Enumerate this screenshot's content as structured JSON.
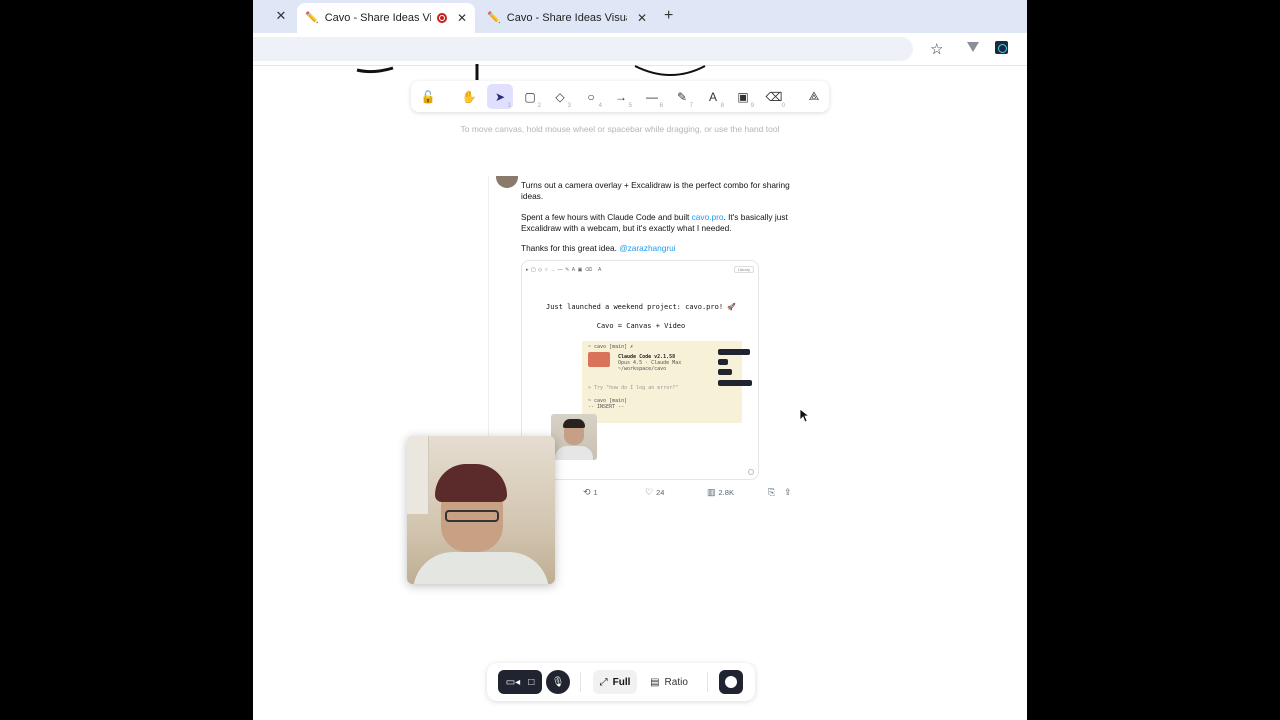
{
  "browser": {
    "tabs": [
      {
        "title": "Cavo - Share Ideas Visually",
        "favicon": "pencil-icon",
        "recording": true,
        "active": true
      },
      {
        "title": "Cavo - Share Ideas Visually |",
        "favicon": "pencil-icon",
        "recording": false,
        "active": false
      }
    ],
    "close_symbol": "✕",
    "new_tab_symbol": "+",
    "bookmark_icon": "☆"
  },
  "toolbar": {
    "tools": [
      {
        "name": "lock-icon",
        "glyph": "🔓",
        "num": ""
      },
      {
        "name": "hand-icon",
        "glyph": "✋",
        "num": ""
      },
      {
        "name": "selection-icon",
        "glyph": "➤",
        "num": "1",
        "selected": true
      },
      {
        "name": "rectangle-icon",
        "glyph": "▢",
        "num": "2"
      },
      {
        "name": "diamond-icon",
        "glyph": "◇",
        "num": "3"
      },
      {
        "name": "ellipse-icon",
        "glyph": "○",
        "num": "4"
      },
      {
        "name": "arrow-icon",
        "glyph": "→",
        "num": "5"
      },
      {
        "name": "line-icon",
        "glyph": "—",
        "num": "6"
      },
      {
        "name": "pencil-icon",
        "glyph": "✎",
        "num": "7"
      },
      {
        "name": "text-icon",
        "glyph": "A",
        "num": "8"
      },
      {
        "name": "image-icon",
        "glyph": "▣",
        "num": "9"
      },
      {
        "name": "eraser-icon",
        "glyph": "⌫",
        "num": "0"
      },
      {
        "name": "shapes-icon",
        "glyph": "⟁",
        "num": ""
      }
    ],
    "hint": "To move canvas, hold mouse wheel or spacebar while dragging, or use the hand tool"
  },
  "tweet": {
    "line1": "Turns out a camera overlay + Excalidraw is the perfect combo for sharing ideas.",
    "p2_before": "Spent a few hours with Claude Code and built ",
    "p2_link": "cavo.pro",
    "p2_after": ". It's basically just Excalidraw with a webcam, but it's exactly what I needed.",
    "p3_before": "Thanks for this great idea. ",
    "p3_link": "@zarazhangrui",
    "media": {
      "library_label": "Library",
      "handwritten_1": "Just launched a weekend project: cavo.pro! 🚀",
      "handwritten_2": "Cavo = Canvas + Video",
      "term_prompt": "~ cavo [main] ✗",
      "term_app": "Claude Code v2.1.58",
      "term_model": "Opus 4.5 · Claude Max",
      "term_path": "~/workspace/cavo",
      "term_input": "> Try \"how do I log an error?\"",
      "term_prompt2": "~ cavo [main]",
      "term_mode": "-- INSERT --"
    },
    "actions": {
      "retweets": "1",
      "likes": "24",
      "views": "2.8K"
    }
  },
  "controls": {
    "full_label": "Full",
    "ratio_label": "Ratio"
  }
}
